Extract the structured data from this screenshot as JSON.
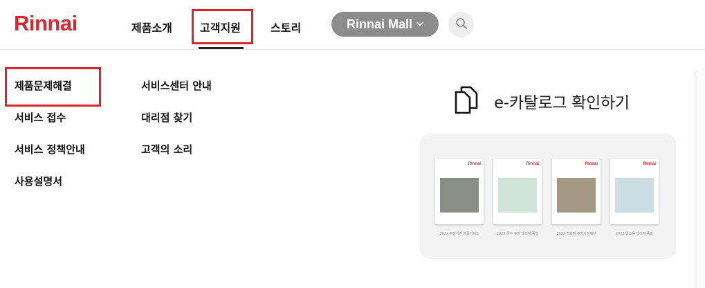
{
  "header": {
    "logo": "Rinnai",
    "nav": [
      {
        "label": "제품소개"
      },
      {
        "label": "고객지원"
      },
      {
        "label": "스토리"
      }
    ],
    "mall_label": "Rinnai Mall"
  },
  "submenu": {
    "col1": [
      {
        "label": "제품문제해결"
      },
      {
        "label": "서비스 접수"
      },
      {
        "label": "서비스 정책안내"
      },
      {
        "label": "사용설명서"
      }
    ],
    "col2": [
      {
        "label": "서비스센터 안내"
      },
      {
        "label": "대리점 찾기"
      },
      {
        "label": "고객의 소리"
      }
    ]
  },
  "catalog": {
    "title": "e-카탈로그 확인하기",
    "books": [
      {
        "brand": "Rinnai",
        "caption": "2022 주방가전 제품가이드",
        "photo_color": "#8a8f86"
      },
      {
        "brand": "Rinnai",
        "caption": "2022 온수·주방 대리점 종합",
        "photo_color": "#cfe3d6"
      },
      {
        "brand": "Rinnai",
        "caption": "2022 백화점 주방가전패턴",
        "photo_color": "#a49a84"
      },
      {
        "brand": "Rinnai",
        "caption": "2022 업소용 대리점 종합",
        "photo_color": "#cbdde3"
      }
    ]
  },
  "colors": {
    "brand_red": "#d7282f",
    "highlight_red": "#d9232d",
    "mall_gray": "#8c8c8c"
  },
  "icons": {
    "search": "search-icon",
    "chevron": "chevron-down-icon",
    "catalog": "documents-icon"
  }
}
